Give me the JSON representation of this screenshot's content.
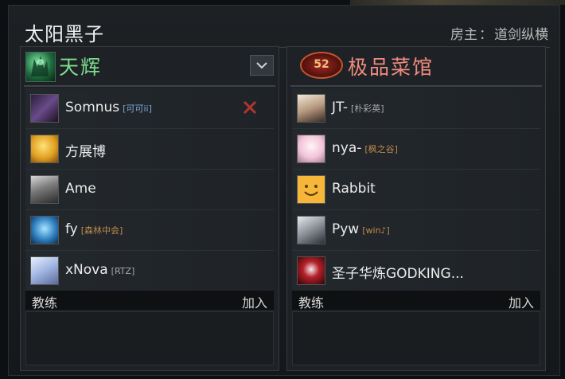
{
  "lobby": {
    "title": "太阳黑子",
    "host_label": "房主",
    "host_sep": "：",
    "host_name": "道剑纵横"
  },
  "teams": {
    "radiant": {
      "name": "天辉",
      "color": "#7ddd8c",
      "players": [
        {
          "name": "Somnus",
          "tag": "[可可ii]",
          "tag_color": "blue",
          "avatar": "dark-hero-avatar"
        },
        {
          "name": "方展博",
          "tag": "",
          "avatar": "golden-beast-avatar"
        },
        {
          "name": "Ame",
          "tag": "",
          "avatar": "grey-figure-avatar"
        },
        {
          "name": "fy",
          "tag": "[森林中会]",
          "tag_color": "orange",
          "avatar": "blue-creature-avatar"
        },
        {
          "name": "xNova",
          "tag": "[RTZ]",
          "tag_color": "grey",
          "avatar": "anime-girl-avatar"
        }
      ]
    },
    "dire": {
      "name": "极品菜馆",
      "logo_text": "52",
      "color": "#f08c7e",
      "players": [
        {
          "name": "JT-",
          "tag": "[朴彩英]",
          "tag_color": "grey",
          "avatar": "portrait-avatar"
        },
        {
          "name": "nya-",
          "tag": "[枫之谷]",
          "tag_color": "orange",
          "avatar": "pink-anime-avatar"
        },
        {
          "name": "Rabbit",
          "tag": "",
          "avatar": "smiley-face-avatar"
        },
        {
          "name": "Pyw",
          "tag": "[win♪]",
          "tag_color": "orange",
          "avatar": "wolf-avatar"
        },
        {
          "name": "圣子华炼GODKING...",
          "tag": "",
          "avatar": "red-mask-avatar"
        }
      ]
    }
  },
  "coach": {
    "label": "教练",
    "join": "加入"
  },
  "icons": {
    "dropdown": "chevron-down-icon",
    "kick": "close-icon",
    "kick_color": "#b0362c"
  }
}
